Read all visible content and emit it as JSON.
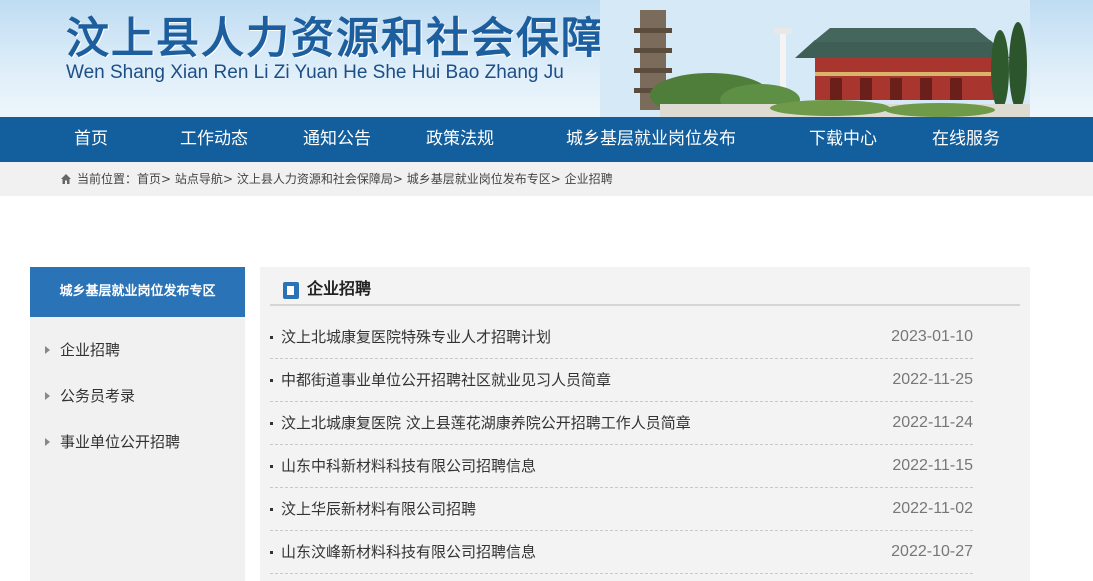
{
  "header": {
    "title": "汶上县人力资源和社会保障局",
    "subtitle": "Wen Shang Xian Ren Li Zi Yuan He She Hui Bao Zhang Ju"
  },
  "nav": {
    "items": [
      {
        "label": "首页"
      },
      {
        "label": "工作动态"
      },
      {
        "label": "通知公告"
      },
      {
        "label": "政策法规"
      },
      {
        "label": "城乡基层就业岗位发布"
      },
      {
        "label": "下载中心"
      },
      {
        "label": "在线服务"
      }
    ]
  },
  "breadcrumb": {
    "prefix": "当前位置：",
    "items": [
      "首页",
      "站点导航",
      "汶上县人力资源和社会保障局",
      "城乡基层就业岗位发布专区",
      "企业招聘"
    ],
    "separator": ">"
  },
  "sidebar": {
    "heading": "城乡基层就业岗位发布专区",
    "items": [
      {
        "label": "企业招聘"
      },
      {
        "label": "公务员考录"
      },
      {
        "label": "事业单位公开招聘"
      }
    ]
  },
  "main": {
    "title": "企业招聘",
    "articles": [
      {
        "title": "汶上北城康复医院特殊专业人才招聘计划",
        "date": "2023-01-10"
      },
      {
        "title": "中都街道事业单位公开招聘社区就业见习人员简章",
        "date": "2022-11-25"
      },
      {
        "title": "汶上北城康复医院 汶上县莲花湖康养院公开招聘工作人员简章",
        "date": "2022-11-24"
      },
      {
        "title": "山东中科新材料科技有限公司招聘信息",
        "date": "2022-11-15"
      },
      {
        "title": "汶上华辰新材料有限公司招聘",
        "date": "2022-11-02"
      },
      {
        "title": "山东汶峰新材料科技有限公司招聘信息",
        "date": "2022-10-27"
      }
    ]
  },
  "colors": {
    "nav_bg": "#135e9c",
    "accent": "#2a73b6",
    "title_blue": "#1d5f9e"
  }
}
